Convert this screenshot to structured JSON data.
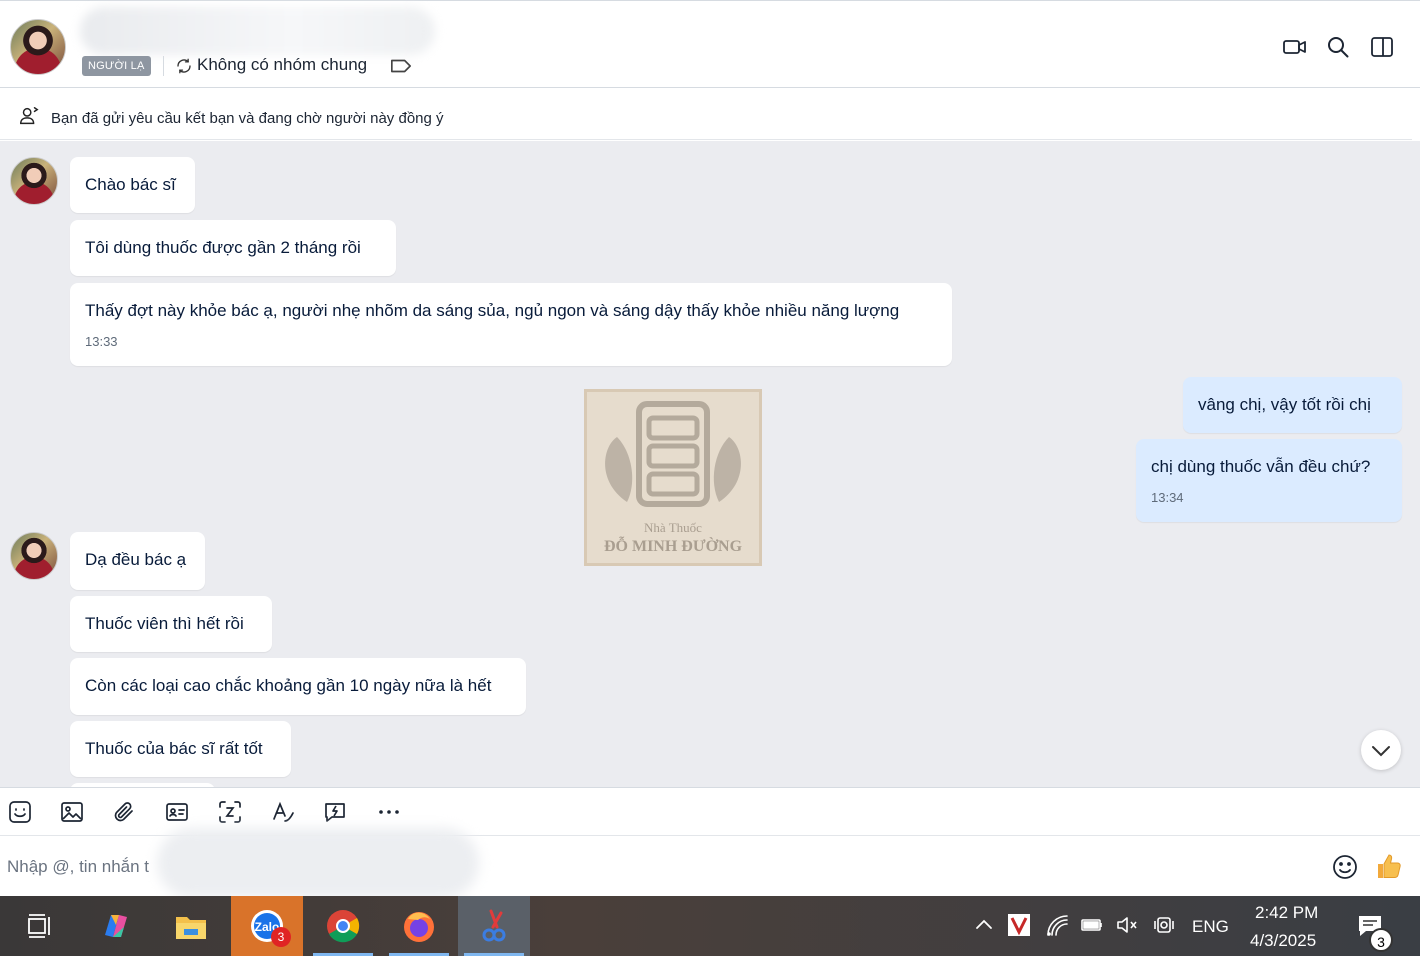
{
  "header": {
    "stranger_badge": "NGƯỜI LẠ",
    "no_common_group": "Không có nhóm chung"
  },
  "friend_request": {
    "text": "Bạn đã gửi yêu cầu kết bạn và đang chờ người này đồng ý"
  },
  "messages": [
    {
      "from": "them",
      "text": "Chào bác sĩ"
    },
    {
      "from": "them",
      "text": "Tôi dùng thuốc được gần 2 tháng rồi"
    },
    {
      "from": "them",
      "text": "Thấy đợt này khỏe bác ạ, người nhẹ nhõm da sáng sủa, ngủ ngon và sáng dậy thấy khỏe nhiều năng lượng",
      "time": "13:33"
    },
    {
      "from": "me",
      "text": "vâng chị, vậy tốt rồi chị"
    },
    {
      "from": "me",
      "text": "chị dùng thuốc vẫn đều chứ?",
      "time": "13:34"
    },
    {
      "from": "them",
      "text": "Dạ đều bác ạ"
    },
    {
      "from": "them",
      "text": "Thuốc viên thì hết rồi"
    },
    {
      "from": "them",
      "text": "Còn các loại cao chắc khoảng gần 10 ngày nữa là hết"
    },
    {
      "from": "them",
      "text": "Thuốc của bác sĩ rất tốt"
    }
  ],
  "watermark": {
    "line1": "Nhà Thuốc",
    "line2": "ĐỖ MINH ĐƯỜNG"
  },
  "composer": {
    "placeholder": "Nhập @, tin nhắn t"
  },
  "taskbar": {
    "zalo_badge": "3",
    "language": "ENG",
    "time": "2:42 PM",
    "date": "4/3/2025",
    "notifications": "3"
  },
  "colors": {
    "chat_bg": "#ebecf0",
    "my_bubble": "#dbebff",
    "their_bubble": "#ffffff",
    "zalo_active": "#d9732a"
  }
}
